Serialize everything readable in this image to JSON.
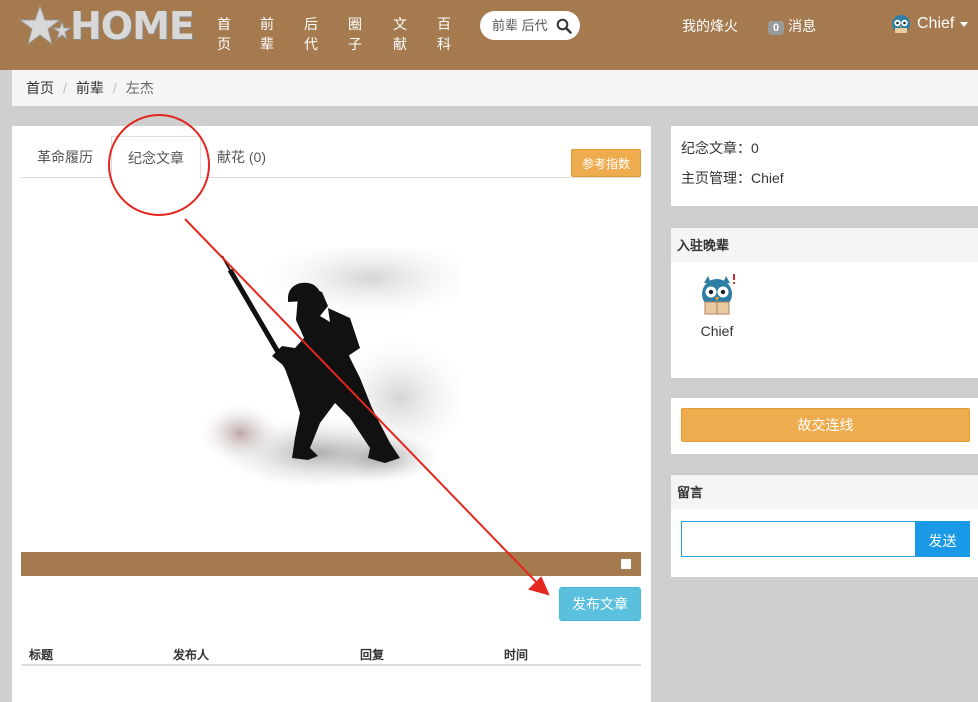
{
  "navbar": {
    "logo_text": "HOME",
    "nav_items": [
      {
        "label": "首页"
      },
      {
        "label": "前辈"
      },
      {
        "label": "后代"
      },
      {
        "label": "圈子"
      },
      {
        "label": "文献"
      },
      {
        "label": "百科"
      }
    ],
    "search_placeholder": "前辈 后代",
    "beacon_label": "我的烽火",
    "message_count": "0",
    "message_label": "消息",
    "username": "Chief"
  },
  "breadcrumb": {
    "items": [
      "首页",
      "前辈",
      "左杰"
    ],
    "separator": "/"
  },
  "tabs": [
    {
      "label": "革命履历",
      "active": false
    },
    {
      "label": "纪念文章",
      "active": true
    },
    {
      "label": "献花 (0)",
      "active": false
    }
  ],
  "ref_index_label": "参考指数",
  "publish_label": "发布文章",
  "table_headers": [
    "标题",
    "发布人",
    "回复",
    "时间"
  ],
  "stats": {
    "articles": "纪念文章：0",
    "manager": "主页管理：Chief"
  },
  "descendants": {
    "heading": "入驻晚辈",
    "members": [
      {
        "name": "Chief"
      }
    ]
  },
  "contact_label": "故交连线",
  "message_board": {
    "heading": "留言",
    "input_value": "",
    "send_label": "发送"
  },
  "colors": {
    "navbar": "#a47a4e",
    "accent_orange": "#efac4e",
    "info_blue": "#5bc0de",
    "send_blue": "#1a9ae6",
    "annotation_red": "#e3261e"
  }
}
